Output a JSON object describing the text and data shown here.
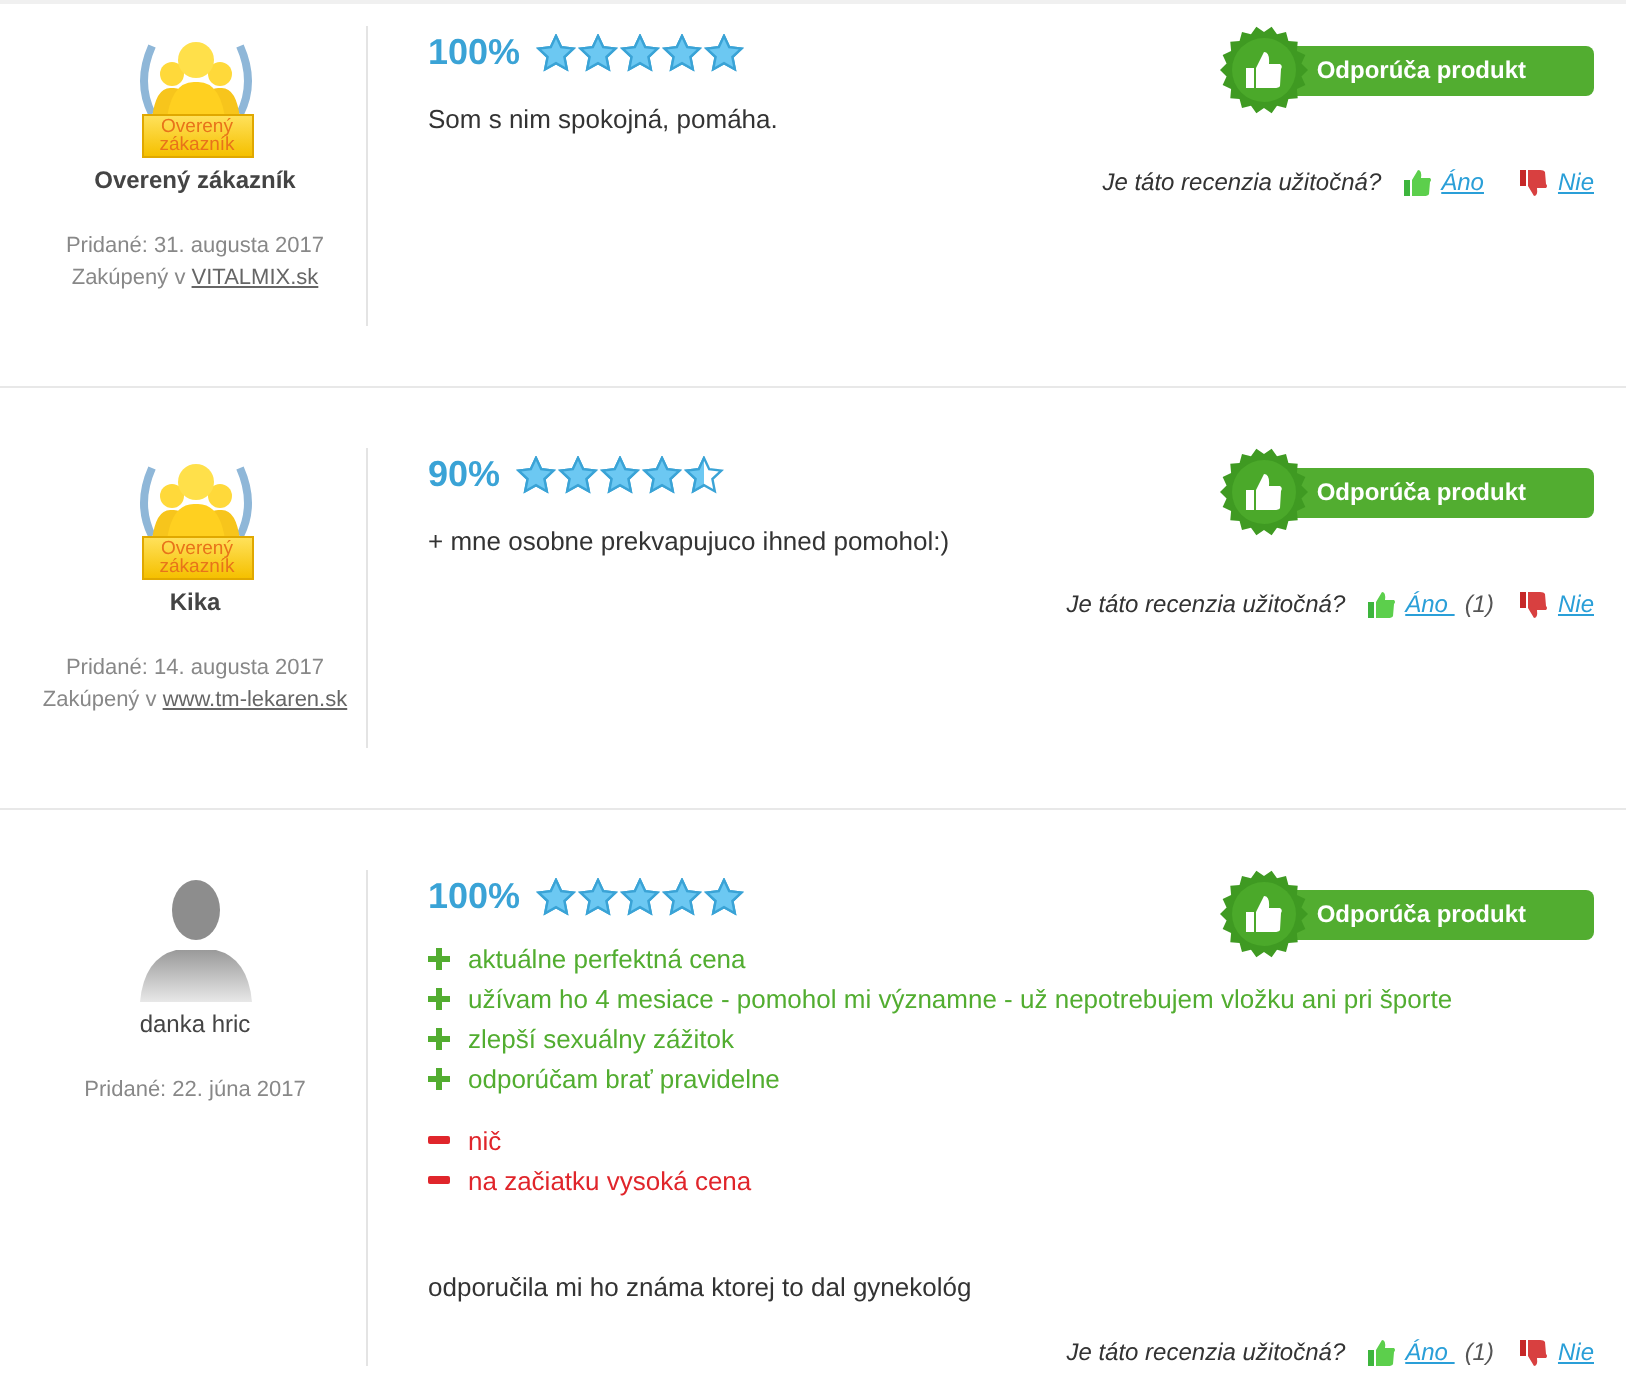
{
  "reviews": [
    {
      "avatar": {
        "kind": "verified",
        "label": "Overený zákazník"
      },
      "author": "Overený zákazník",
      "added": "Pridané: 31. augusta 2017",
      "purchased": {
        "prefix": "Zakúpený v",
        "shop": "VITALMIX.sk"
      },
      "score": "100%",
      "stars": 5,
      "recommend": "Odporúča produkt",
      "text": "Som s nim spokojná, pomáha.",
      "helpful": {
        "question": "Je táto recenzia užitočná?",
        "yes": "Áno",
        "no": "Nie"
      }
    },
    {
      "avatar": {
        "kind": "verified",
        "label": "Overený zákazník"
      },
      "author": "Kika",
      "added": "Pridané: 14. augusta 2017",
      "purchased": {
        "prefix": "Zakúpený v",
        "shop": "www.tm-lekaren.sk"
      },
      "score": "90%",
      "stars": 4.5,
      "recommend": "Odporúča produkt",
      "text": "+ mne osobne prekvapujuco ihned pomohol:)",
      "helpful": {
        "question": "Je táto recenzia užitočná?",
        "yes": "Áno",
        "yes_count": "(1)",
        "no": "Nie"
      }
    },
    {
      "avatar": {
        "kind": "silhouette"
      },
      "author": "danka hric",
      "added": "Pridané: 22. júna 2017",
      "score": "100%",
      "stars": 5,
      "recommend": "Odporúča produkt",
      "points": [
        {
          "kind": "pro",
          "text": "aktuálne perfektná cena"
        },
        {
          "kind": "pro",
          "text": "užívam ho 4 mesiace - pomohol mi významne - už nepotrebujem vložku ani pri športe"
        },
        {
          "kind": "pro",
          "text": "zlepší sexuálny zážitok"
        },
        {
          "kind": "pro",
          "text": "odporúčam brať pravidelne"
        },
        {
          "kind": "con",
          "text": "nič"
        },
        {
          "kind": "con",
          "text": "na začiatku vysoká cena"
        }
      ],
      "text": "odporučila mi ho známa ktorej to dal gynekológ",
      "helpful": {
        "question": "Je táto recenzia užitočná?",
        "yes": "Áno",
        "yes_count": "(1)",
        "no": "Nie"
      }
    }
  ]
}
